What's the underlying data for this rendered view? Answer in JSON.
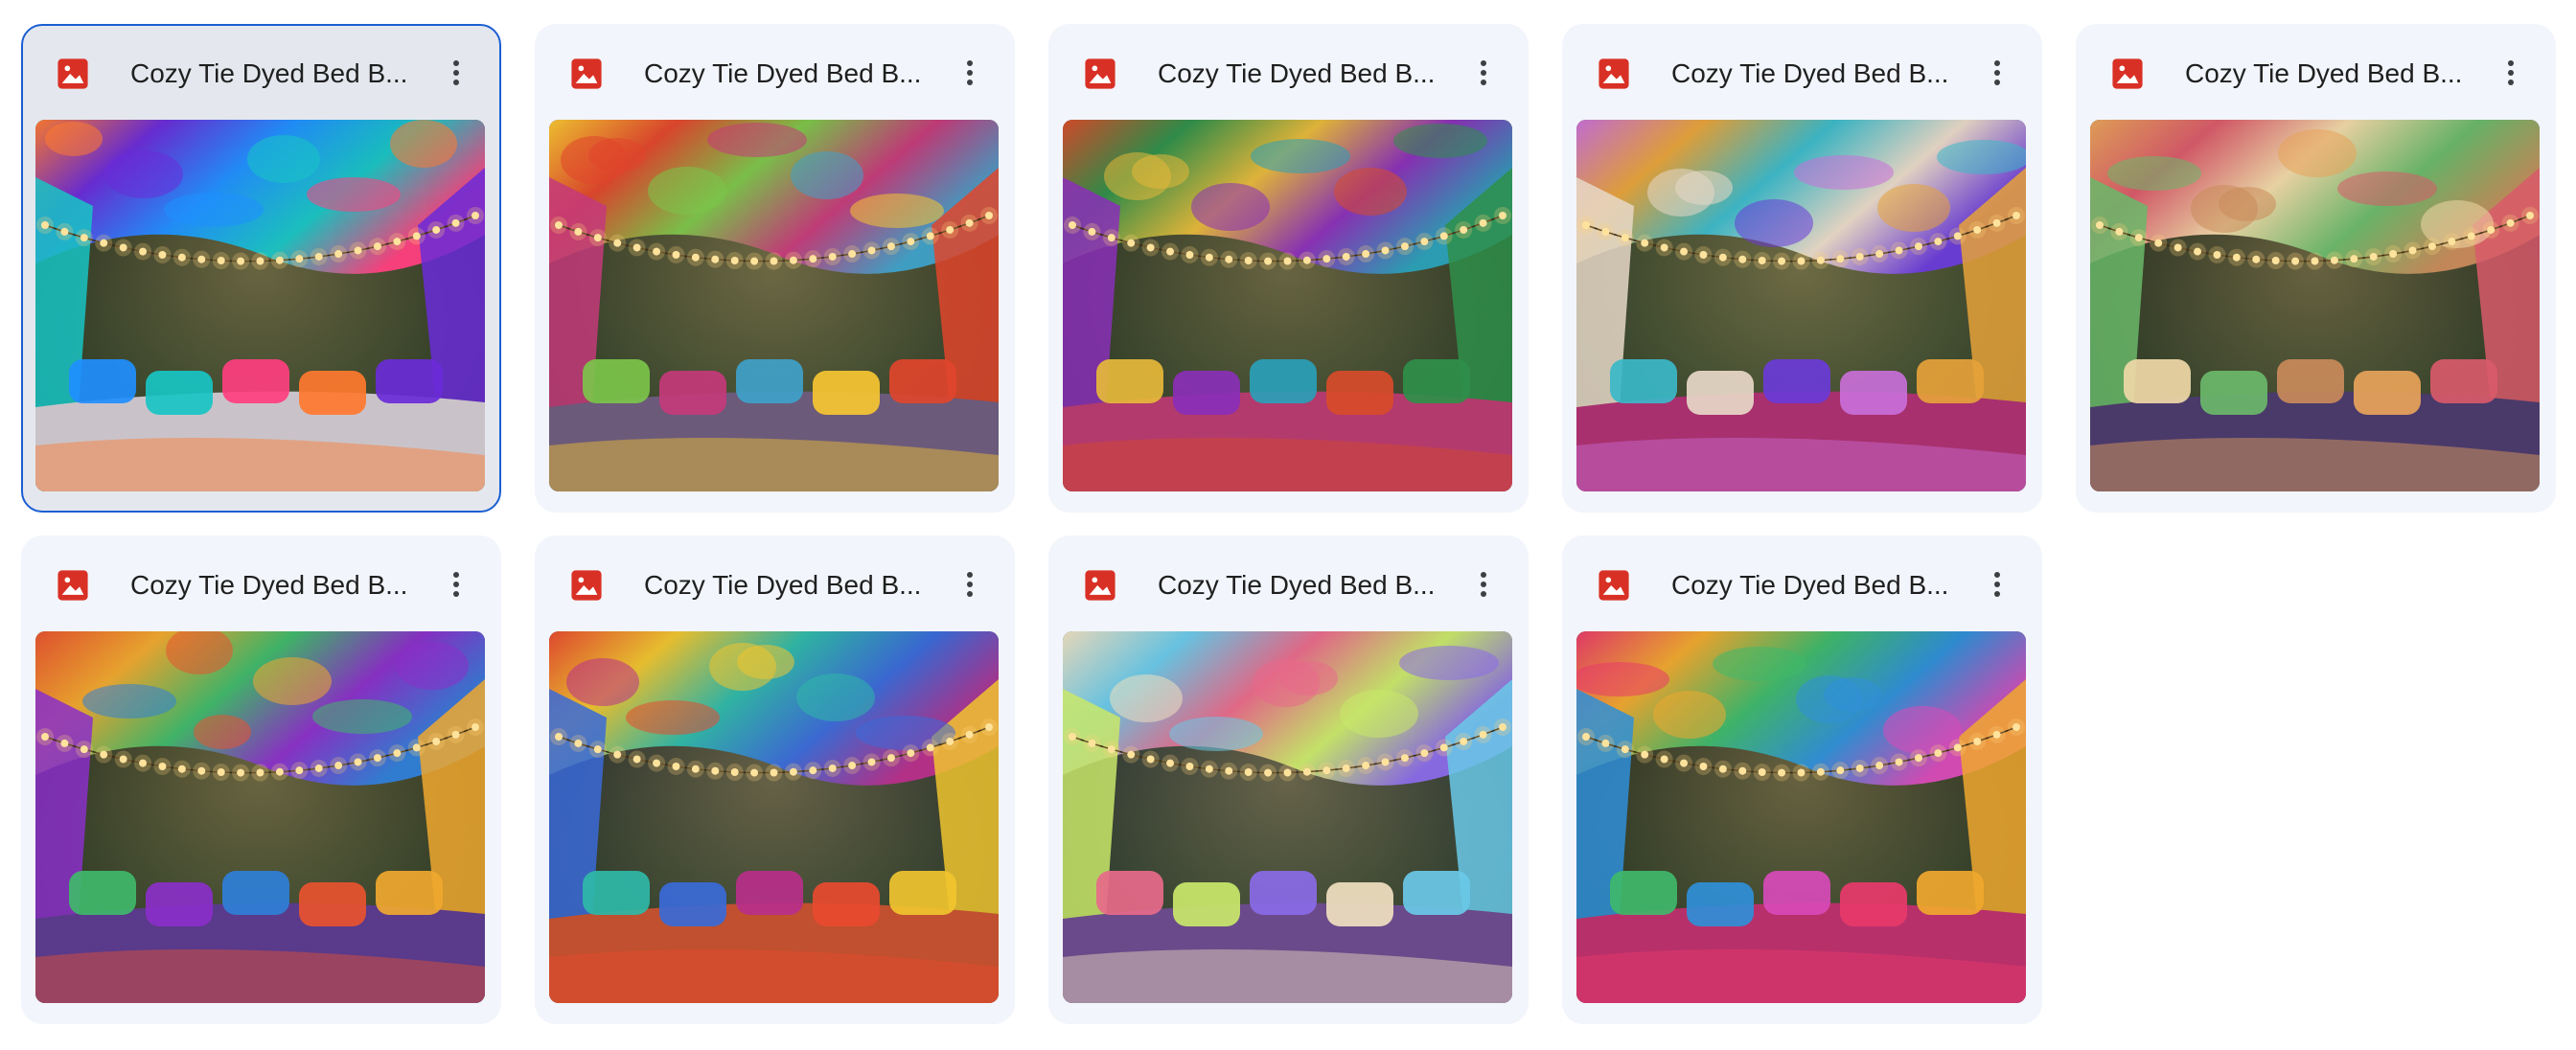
{
  "files": [
    {
      "name": "Cozy Tie Dyed Bed B...",
      "selected": true,
      "canopy": [
        "#ff7a2f",
        "#6a2bd8",
        "#1f8fff",
        "#18c4c4",
        "#ff3f7f"
      ],
      "bg": "#0e1a10",
      "bed": "#c9c3c9"
    },
    {
      "name": "Cozy Tie Dyed Bed B...",
      "selected": false,
      "canopy": [
        "#f7c531",
        "#e0452c",
        "#7cc44a",
        "#c43a7a",
        "#3fa1c9"
      ],
      "bg": "#1a2418",
      "bed": "#6b5a7a"
    },
    {
      "name": "Cozy Tie Dyed Bed B...",
      "selected": false,
      "canopy": [
        "#d84b2a",
        "#2f8f4a",
        "#e6b83a",
        "#8a2fb8",
        "#2aa0b8"
      ],
      "bg": "#0d1a12",
      "bed": "#b33a6c"
    },
    {
      "name": "Cozy Tie Dyed Bed B...",
      "selected": false,
      "canopy": [
        "#c96fd8",
        "#e6a23a",
        "#3bb8c9",
        "#e8d8c8",
        "#6a3bd8"
      ],
      "bg": "#1b2b1a",
      "bed": "#a8306e"
    },
    {
      "name": "Cozy Tie Dyed Bed B...",
      "selected": false,
      "canopy": [
        "#e8a35a",
        "#d85a6a",
        "#f0d8a8",
        "#6ab86a",
        "#c98a5a"
      ],
      "bg": "#0c140f",
      "bed": "#4a3a6a"
    },
    {
      "name": "Cozy Tie Dyed Bed B...",
      "selected": false,
      "canopy": [
        "#e8532f",
        "#f0a82f",
        "#3fb86a",
        "#8a2fc9",
        "#2f7fd8"
      ],
      "bg": "#101a10",
      "bed": "#5a3a8a"
    },
    {
      "name": "Cozy Tie Dyed Bed B...",
      "selected": false,
      "canopy": [
        "#e84a2f",
        "#f0c42f",
        "#2fb8a8",
        "#3a6ad8",
        "#b82f8a"
      ],
      "bg": "#0a1420",
      "bed": "#c0502f"
    },
    {
      "name": "Cozy Tie Dyed Bed B...",
      "selected": false,
      "canopy": [
        "#f0e0c0",
        "#6ac9e8",
        "#e86a8a",
        "#c9e86a",
        "#8a6ae8"
      ],
      "bg": "#0a1828",
      "bed": "#6a4a8a"
    },
    {
      "name": "Cozy Tie Dyed Bed B...",
      "selected": false,
      "canopy": [
        "#e83a6a",
        "#f0a82f",
        "#3fb86a",
        "#2f8fd8",
        "#d84ab8"
      ],
      "bg": "#0c1410",
      "bed": "#b8306a"
    }
  ],
  "icons": {
    "file_type": "image-file-icon",
    "more": "more-vertical-icon"
  },
  "colors": {
    "file_icon": "#d93025",
    "selected_border": "#1a5fd3",
    "card_bg": "#f2f5fb",
    "selected_card_bg": "#e4e8ee"
  }
}
